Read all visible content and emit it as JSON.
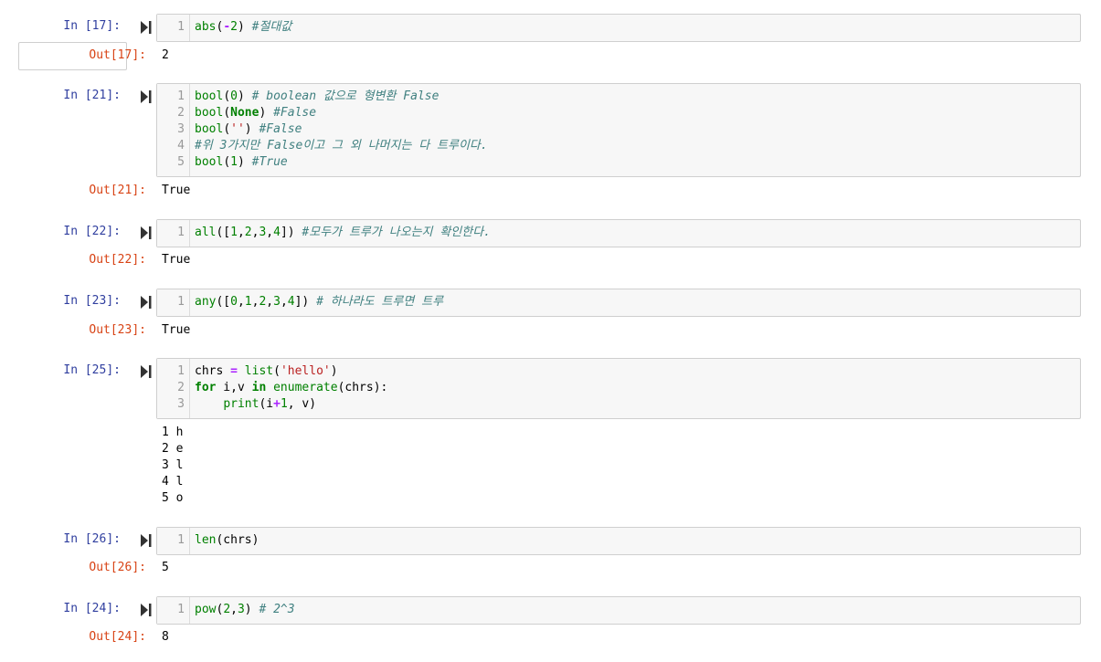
{
  "cells": [
    {
      "in_prompt": "In [17]:",
      "code_lines": [
        [
          {
            "t": "abs",
            "c": "bi"
          },
          {
            "t": "(",
            "c": ""
          },
          {
            "t": "-",
            "c": "op"
          },
          {
            "t": "2",
            "c": "num"
          },
          {
            "t": ") ",
            "c": ""
          },
          {
            "t": "#절대값",
            "c": "cm"
          }
        ]
      ],
      "line_numbers": [
        "1"
      ],
      "out_prompt": "Out[17]:",
      "output": "2"
    },
    {
      "in_prompt": "In [21]:",
      "code_lines": [
        [
          {
            "t": "bool",
            "c": "bi"
          },
          {
            "t": "(",
            "c": ""
          },
          {
            "t": "0",
            "c": "num"
          },
          {
            "t": ") ",
            "c": ""
          },
          {
            "t": "# boolean 값으로 형변환 False",
            "c": "cm"
          }
        ],
        [
          {
            "t": "bool",
            "c": "bi"
          },
          {
            "t": "(",
            "c": ""
          },
          {
            "t": "None",
            "c": "kw"
          },
          {
            "t": ") ",
            "c": ""
          },
          {
            "t": "#False",
            "c": "cm"
          }
        ],
        [
          {
            "t": "bool",
            "c": "bi"
          },
          {
            "t": "(",
            "c": ""
          },
          {
            "t": "''",
            "c": "str"
          },
          {
            "t": ") ",
            "c": ""
          },
          {
            "t": "#False",
            "c": "cm"
          }
        ],
        [
          {
            "t": "#위 3가지만 False이고 그 외 나머지는 다 트루이다.",
            "c": "cm"
          }
        ],
        [
          {
            "t": "bool",
            "c": "bi"
          },
          {
            "t": "(",
            "c": ""
          },
          {
            "t": "1",
            "c": "num"
          },
          {
            "t": ") ",
            "c": ""
          },
          {
            "t": "#True",
            "c": "cm"
          }
        ]
      ],
      "line_numbers": [
        "1",
        "2",
        "3",
        "4",
        "5"
      ],
      "out_prompt": "Out[21]:",
      "output": "True"
    },
    {
      "in_prompt": "In [22]:",
      "code_lines": [
        [
          {
            "t": "all",
            "c": "bi"
          },
          {
            "t": "([",
            "c": ""
          },
          {
            "t": "1",
            "c": "num"
          },
          {
            "t": ",",
            "c": ""
          },
          {
            "t": "2",
            "c": "num"
          },
          {
            "t": ",",
            "c": ""
          },
          {
            "t": "3",
            "c": "num"
          },
          {
            "t": ",",
            "c": ""
          },
          {
            "t": "4",
            "c": "num"
          },
          {
            "t": "]) ",
            "c": ""
          },
          {
            "t": "#모두가 트루가 나오는지 확인한다.",
            "c": "cm"
          }
        ]
      ],
      "line_numbers": [
        "1"
      ],
      "out_prompt": "Out[22]:",
      "output": "True"
    },
    {
      "in_prompt": "In [23]:",
      "code_lines": [
        [
          {
            "t": "any",
            "c": "bi"
          },
          {
            "t": "([",
            "c": ""
          },
          {
            "t": "0",
            "c": "num"
          },
          {
            "t": ",",
            "c": ""
          },
          {
            "t": "1",
            "c": "num"
          },
          {
            "t": ",",
            "c": ""
          },
          {
            "t": "2",
            "c": "num"
          },
          {
            "t": ",",
            "c": ""
          },
          {
            "t": "3",
            "c": "num"
          },
          {
            "t": ",",
            "c": ""
          },
          {
            "t": "4",
            "c": "num"
          },
          {
            "t": "]) ",
            "c": ""
          },
          {
            "t": "# 하나라도 트루면 트루",
            "c": "cm"
          }
        ]
      ],
      "line_numbers": [
        "1"
      ],
      "out_prompt": "Out[23]:",
      "output": "True"
    },
    {
      "in_prompt": "In [25]:",
      "code_lines": [
        [
          {
            "t": "chrs ",
            "c": ""
          },
          {
            "t": "=",
            "c": "op"
          },
          {
            "t": " ",
            "c": ""
          },
          {
            "t": "list",
            "c": "bi"
          },
          {
            "t": "(",
            "c": ""
          },
          {
            "t": "'hello'",
            "c": "str"
          },
          {
            "t": ")",
            "c": ""
          }
        ],
        [
          {
            "t": "for",
            "c": "kw"
          },
          {
            "t": " i,v ",
            "c": ""
          },
          {
            "t": "in",
            "c": "kw"
          },
          {
            "t": " ",
            "c": ""
          },
          {
            "t": "enumerate",
            "c": "bi"
          },
          {
            "t": "(chrs):",
            "c": ""
          }
        ],
        [
          {
            "t": "    ",
            "c": ""
          },
          {
            "t": "print",
            "c": "bi"
          },
          {
            "t": "(i",
            "c": ""
          },
          {
            "t": "+",
            "c": "op"
          },
          {
            "t": "1",
            "c": "num"
          },
          {
            "t": ", v)",
            "c": ""
          }
        ]
      ],
      "line_numbers": [
        "1",
        "2",
        "3"
      ],
      "out_prompt": "",
      "output": "1 h\n2 e\n3 l\n4 l\n5 o"
    },
    {
      "in_prompt": "In [26]:",
      "code_lines": [
        [
          {
            "t": "len",
            "c": "bi"
          },
          {
            "t": "(chrs)",
            "c": ""
          }
        ]
      ],
      "line_numbers": [
        "1"
      ],
      "out_prompt": "Out[26]:",
      "output": "5"
    },
    {
      "in_prompt": "In [24]:",
      "code_lines": [
        [
          {
            "t": "pow",
            "c": "bi"
          },
          {
            "t": "(",
            "c": ""
          },
          {
            "t": "2",
            "c": "num"
          },
          {
            "t": ",",
            "c": ""
          },
          {
            "t": "3",
            "c": "num"
          },
          {
            "t": ") ",
            "c": ""
          },
          {
            "t": "# 2^3",
            "c": "cm"
          }
        ]
      ],
      "line_numbers": [
        "1"
      ],
      "out_prompt": "Out[24]:",
      "output": "8"
    }
  ],
  "icons": {
    "run": "run-cell-icon"
  },
  "colors": {
    "in_prompt": "#303F9F",
    "out_prompt": "#D84315",
    "cell_bg": "#f7f7f7"
  }
}
